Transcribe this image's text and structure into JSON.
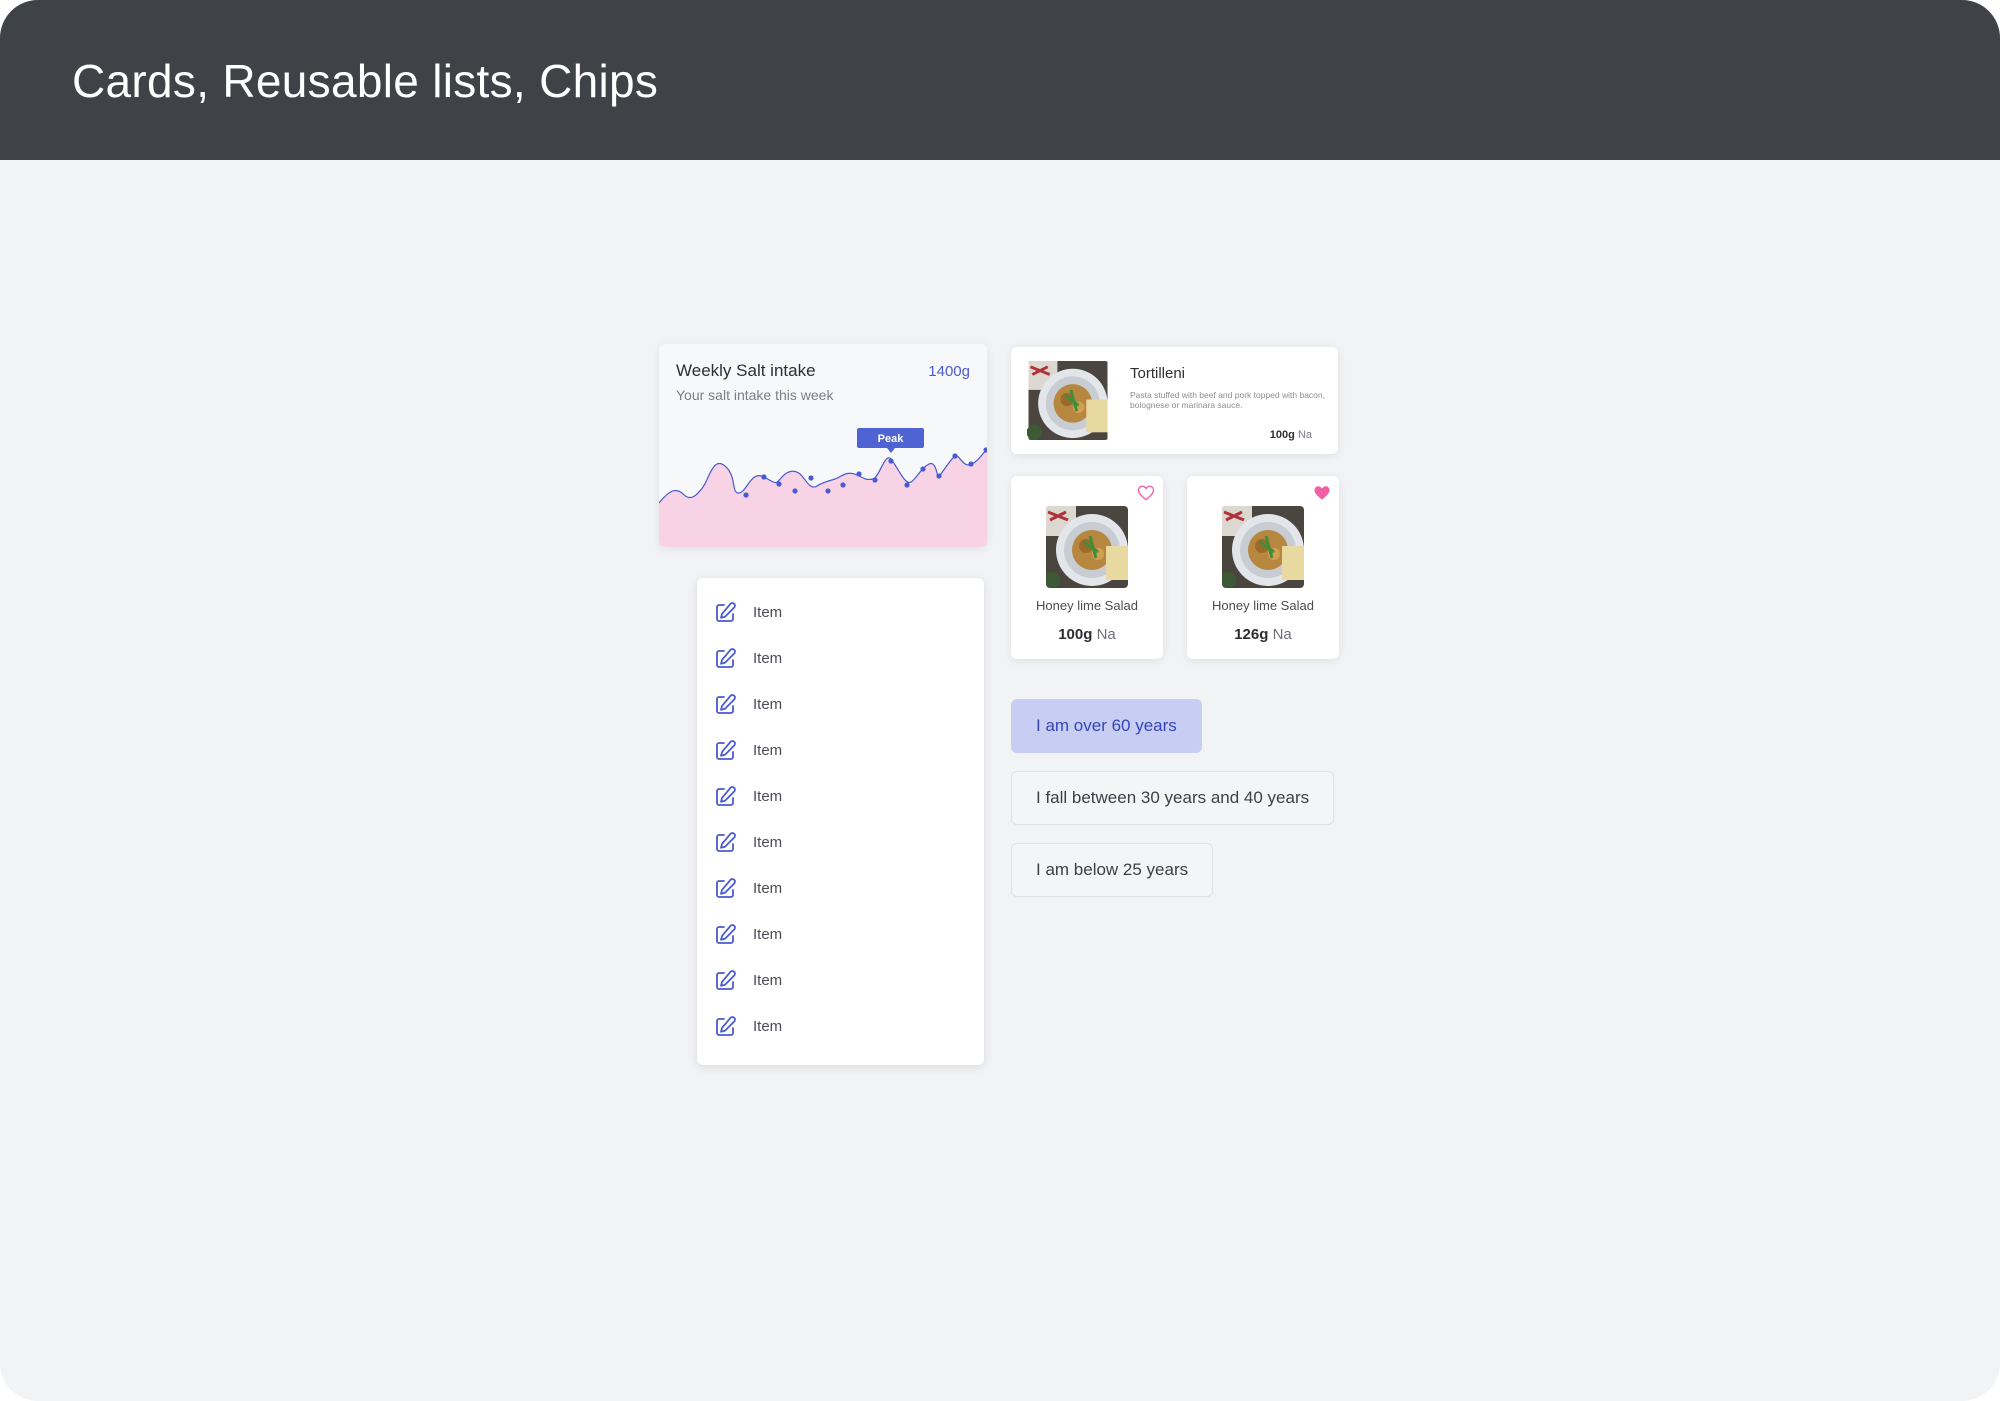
{
  "page": {
    "title": "Cards, Reusable lists, Chips"
  },
  "salt_card": {
    "title": "Weekly Salt intake",
    "value": "1400g",
    "subtitle": "Your salt intake this week",
    "peak_label": "Peak",
    "line_color": "#4a5bd0",
    "fill_color": "#f8d3e6",
    "peak_color": "#4f63d2"
  },
  "list": {
    "items": [
      {
        "label": "Item",
        "icon": "edit-icon"
      },
      {
        "label": "Item",
        "icon": "edit-icon"
      },
      {
        "label": "Item",
        "icon": "edit-icon"
      },
      {
        "label": "Item",
        "icon": "edit-icon"
      },
      {
        "label": "Item",
        "icon": "edit-icon"
      },
      {
        "label": "Item",
        "icon": "edit-icon"
      },
      {
        "label": "Item",
        "icon": "edit-icon"
      },
      {
        "label": "Item",
        "icon": "edit-icon"
      },
      {
        "label": "Item",
        "icon": "edit-icon"
      },
      {
        "label": "Item",
        "icon": "edit-icon"
      }
    ],
    "icon_color": "#4a5bd0"
  },
  "product_card": {
    "name": "Tortilleni",
    "description": "Pasta stuffed with beef and pork topped with bacon, bolognese or marinara sauce.",
    "amount": "100g",
    "unit": "Na"
  },
  "salad_cards": [
    {
      "name": "Honey lime Salad",
      "amount": "100g",
      "unit": "Na",
      "favorite": false,
      "heart_icon": "heart-outline-icon"
    },
    {
      "name": "Honey lime Salad",
      "amount": "126g",
      "unit": "Na",
      "favorite": true,
      "heart_icon": "heart-filled-icon"
    }
  ],
  "chips": [
    {
      "label": "I am over 60 years",
      "selected": true
    },
    {
      "label": "I fall between 30 years and 40 years",
      "selected": false
    },
    {
      "label": "I am below 25 years",
      "selected": false
    }
  ],
  "colors": {
    "header_bg": "#3f4347",
    "page_bg": "#f2f3f5",
    "heart_pink": "#f25fa5"
  }
}
